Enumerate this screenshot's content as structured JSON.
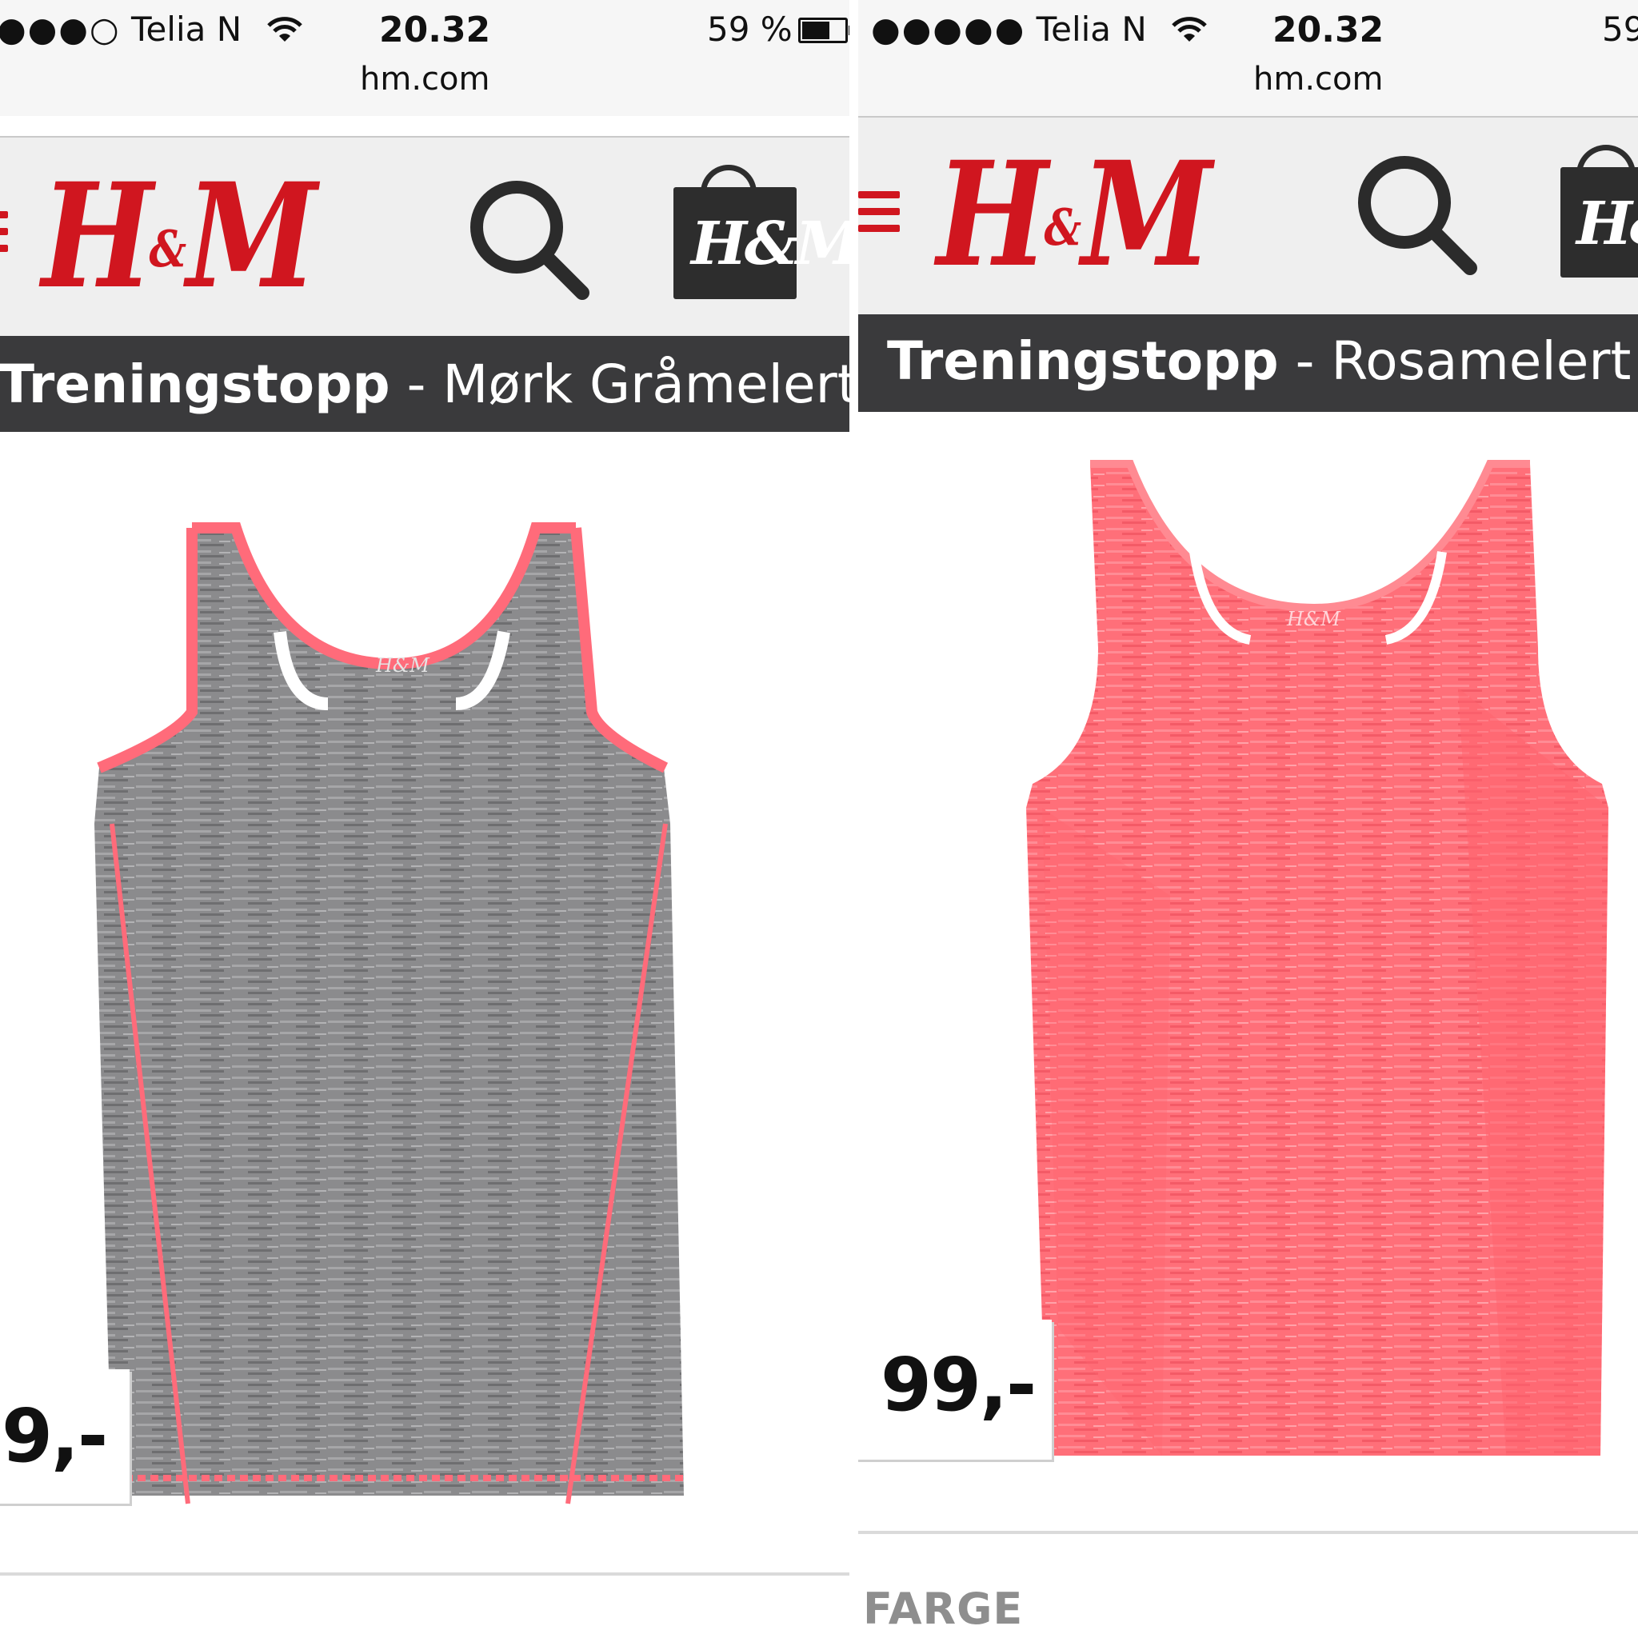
{
  "left": {
    "status": {
      "signal": "●●●○",
      "carrier": "Telia N",
      "time": "20.32",
      "battery_text": "59 %",
      "battery_level": 0.59,
      "url": "hm.com"
    },
    "brand": {
      "logo_left": "H",
      "logo_amp": "&",
      "logo_right": "M",
      "bag_logo": "H&M"
    },
    "product": {
      "name": "Treningstopp",
      "separator": " - ",
      "color": "Mørk Gråmelert",
      "price": "9,-"
    },
    "icons": [
      "menu-icon",
      "search-icon",
      "shopping-bag-icon"
    ],
    "colors": {
      "fabric": "#8a8a8c",
      "trim": "#ff6b7a",
      "brand_red": "#d0161f",
      "header_bar": "#3a3a3c"
    }
  },
  "right": {
    "status": {
      "signal": "●●●●●",
      "carrier": "Telia N",
      "time": "20.32",
      "battery_text": "59",
      "url": "hm.com"
    },
    "brand": {
      "logo_left": "H",
      "logo_amp": "&",
      "logo_right": "M",
      "bag_logo": "H&M"
    },
    "product": {
      "name": "Treningstopp",
      "separator": " - ",
      "color": "Rosamelert",
      "price": "99,-",
      "section_label": "FARGE"
    },
    "icons": [
      "menu-icon",
      "search-icon",
      "shopping-bag-icon"
    ],
    "colors": {
      "fabric": "#ff6e78",
      "trim": "#ff8a92",
      "brand_red": "#d0161f",
      "header_bar": "#3a3a3c"
    }
  }
}
